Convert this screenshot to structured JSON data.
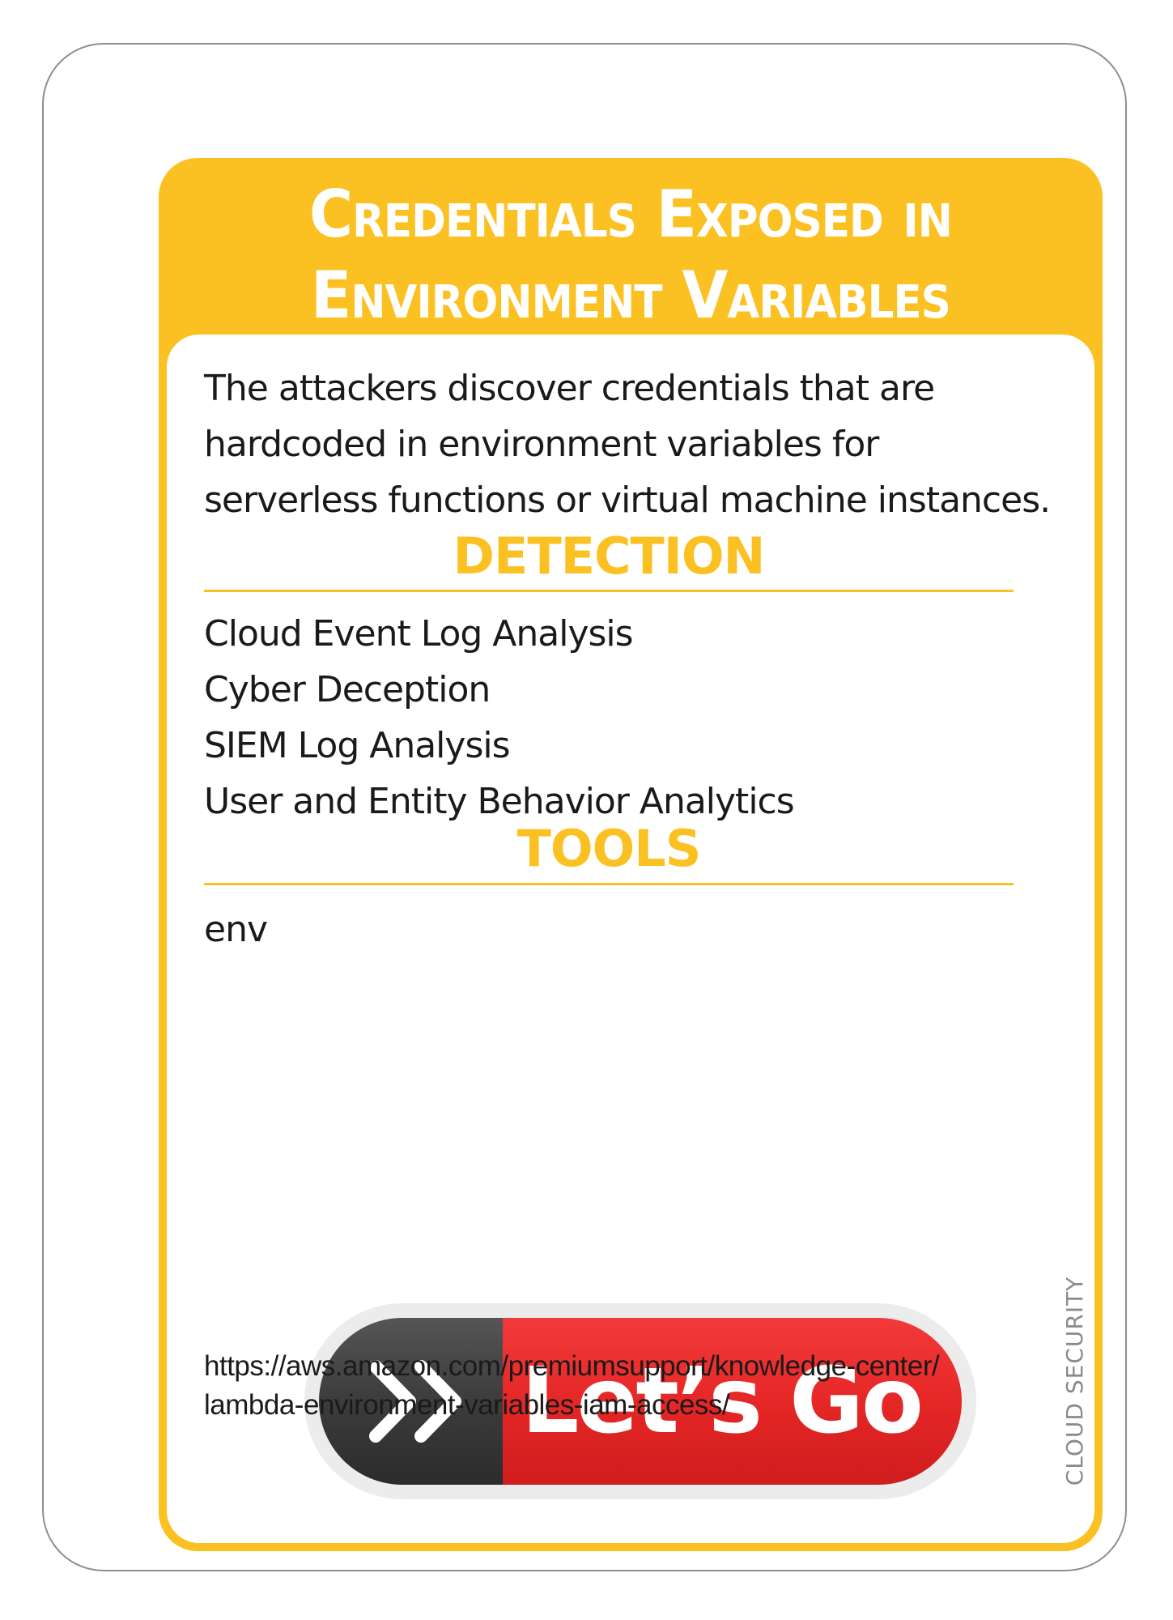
{
  "card": {
    "title_line1": "Credentials Exposed in",
    "title_line2": "Environment Variables",
    "description": "The attackers discover credentials that are hardcoded in environment variables for serverless functions or virtual machine instances.",
    "description_lines": [
      "The attackers discover credentials that are",
      "hardcoded in environment variables for",
      "serverless functions or virtual machine instances."
    ],
    "detection": {
      "heading": "DETECTION",
      "items": [
        "Cloud Event Log Analysis",
        "Cyber Deception",
        "SIEM Log Analysis",
        "User and Entity Behavior Analytics"
      ]
    },
    "tools": {
      "heading": "TOOLS",
      "items": [
        "env"
      ]
    },
    "category": "CLOUD SECURITY",
    "button": {
      "label": "Let’s Go",
      "icon": "double-chevron-right-icon"
    },
    "reference_url_line1": "https://aws.amazon.com/premiumsupport/knowledge-center/",
    "reference_url_line2": "lambda-environment-variables-iam-access/"
  },
  "colors": {
    "accent_yellow": "#fbc122",
    "button_red": "#e42625",
    "button_dark": "#3c3c3c",
    "card_border": "#8e8e8e",
    "text": "#1a1a1a",
    "category_gray": "#8a8a8a"
  }
}
